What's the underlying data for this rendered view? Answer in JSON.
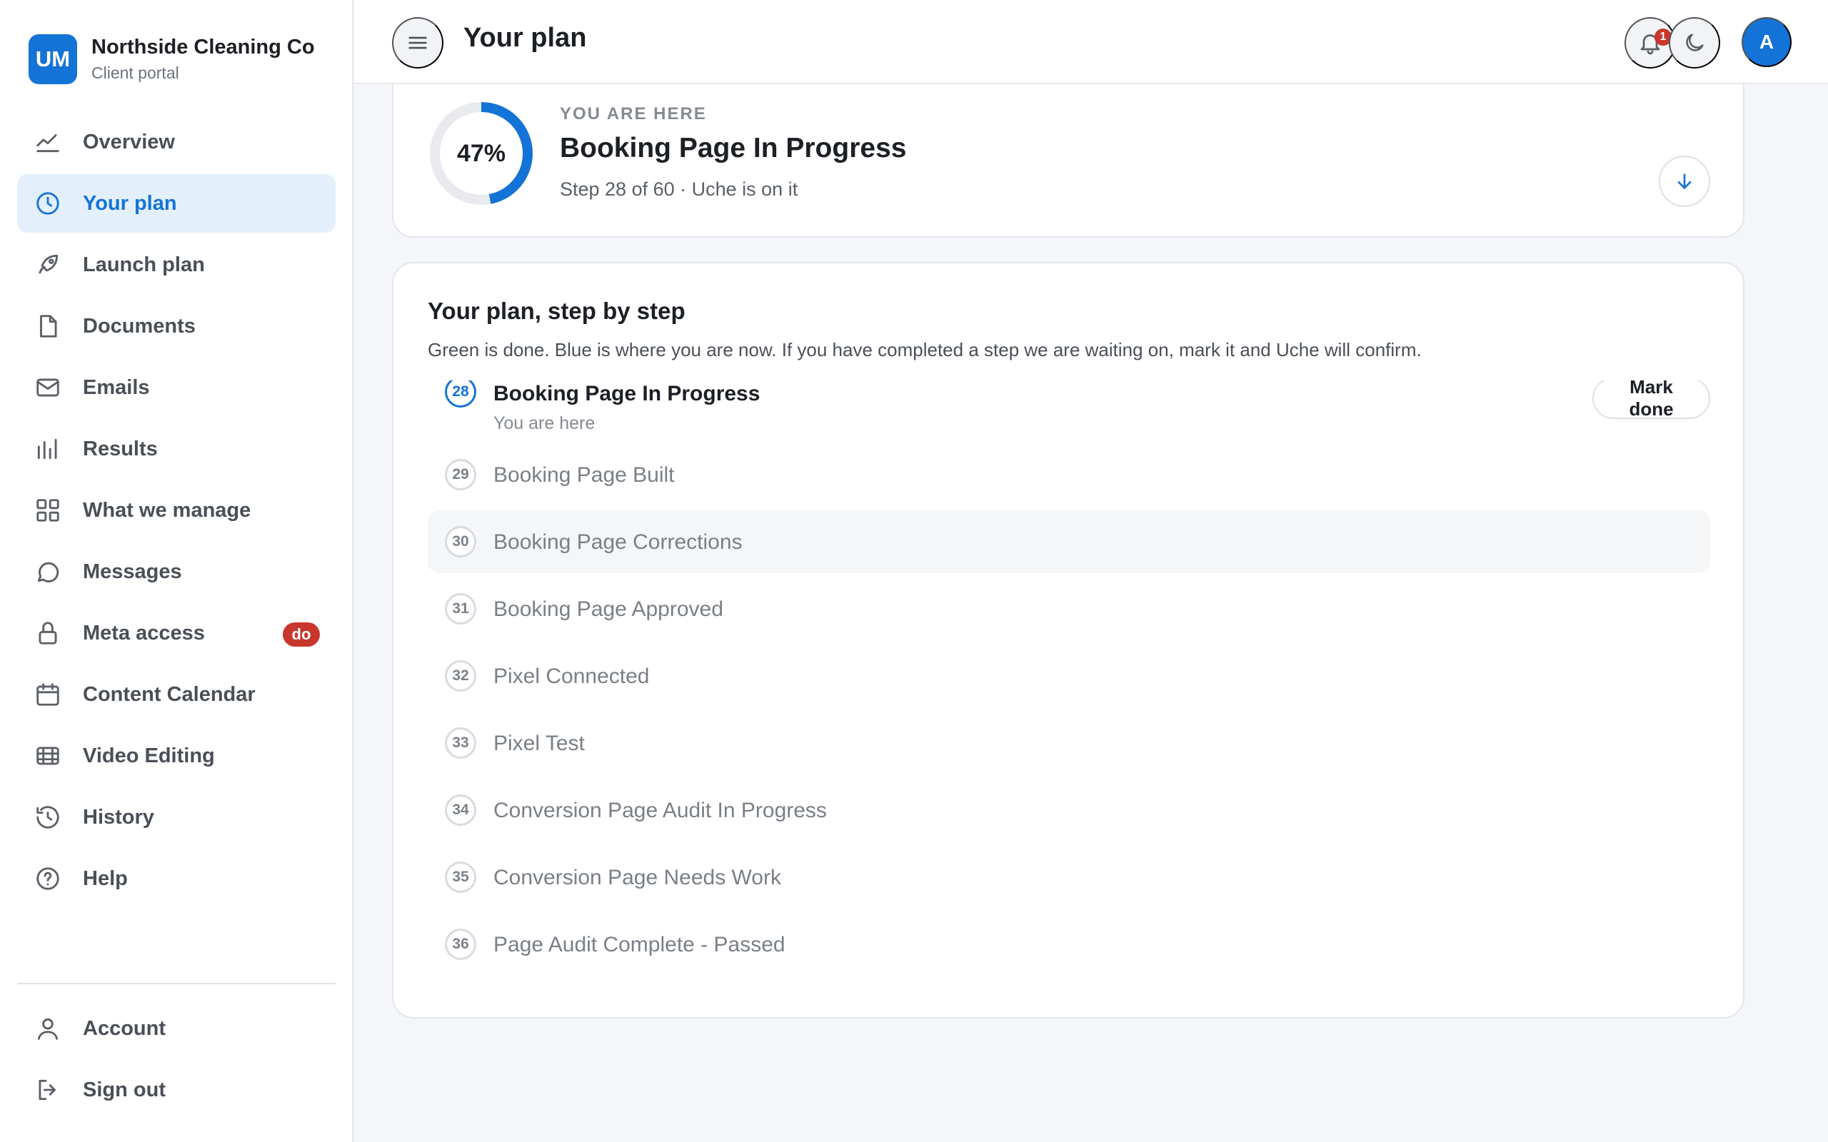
{
  "brand": {
    "initials": "UM",
    "name": "Northside Cleaning Co",
    "subtitle": "Client portal"
  },
  "sidebar": {
    "items": [
      {
        "label": "Overview",
        "icon": "chart-line-icon"
      },
      {
        "label": "Your plan",
        "icon": "clock-icon",
        "active": true
      },
      {
        "label": "Launch plan",
        "icon": "rocket-icon"
      },
      {
        "label": "Documents",
        "icon": "document-icon"
      },
      {
        "label": "Emails",
        "icon": "mail-icon"
      },
      {
        "label": "Results",
        "icon": "bar-chart-icon"
      },
      {
        "label": "What we manage",
        "icon": "grid-icon"
      },
      {
        "label": "Messages",
        "icon": "chat-bubble-icon"
      },
      {
        "label": "Meta access",
        "icon": "lock-icon",
        "badge": "do"
      },
      {
        "label": "Content Calendar",
        "icon": "calendar-icon"
      },
      {
        "label": "Video Editing",
        "icon": "film-icon"
      },
      {
        "label": "History",
        "icon": "history-icon"
      },
      {
        "label": "Help",
        "icon": "help-circle-icon"
      }
    ],
    "footer": [
      {
        "label": "Account",
        "icon": "user-icon"
      },
      {
        "label": "Sign out",
        "icon": "sign-out-icon"
      }
    ]
  },
  "topbar": {
    "title": "Your plan",
    "notification_count": "1",
    "avatar_initial": "A"
  },
  "status": {
    "kicker": "YOU ARE HERE",
    "title": "Booking Page In Progress",
    "subtitle": "Step 28 of 60 · Uche is on it",
    "percent": 47,
    "percent_label": "47%"
  },
  "steps": {
    "title": "Your plan, step by step",
    "description": "Green is done. Blue is where you are now. If you have completed a step we are waiting on, mark it and Uche will confirm.",
    "mark_done_label": "Mark done",
    "items": [
      {
        "number": "28",
        "label": "Booking Page In Progress",
        "sub": "You are here",
        "current": true
      },
      {
        "number": "29",
        "label": "Booking Page Built"
      },
      {
        "number": "30",
        "label": "Booking Page Corrections"
      },
      {
        "number": "31",
        "label": "Booking Page Approved"
      },
      {
        "number": "32",
        "label": "Pixel Connected"
      },
      {
        "number": "33",
        "label": "Pixel Test"
      },
      {
        "number": "34",
        "label": "Conversion Page Audit In Progress"
      },
      {
        "number": "35",
        "label": "Conversion Page Needs Work"
      },
      {
        "number": "36",
        "label": "Page Audit Complete - Passed"
      }
    ]
  },
  "colors": {
    "accent": "#1473d6",
    "accent_light": "#e3f0fb",
    "badge_red": "#c8372d",
    "ring_track": "#e8eaee"
  }
}
